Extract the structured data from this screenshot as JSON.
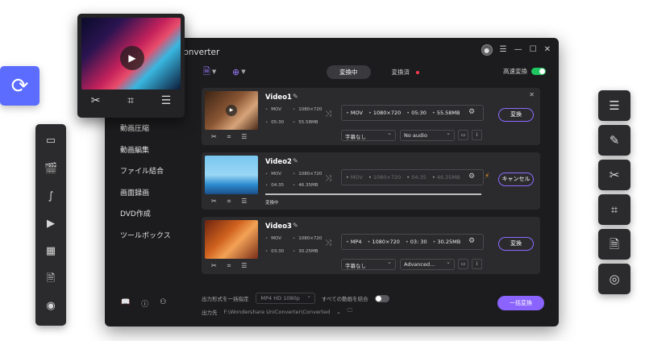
{
  "window": {
    "title": "Converter",
    "controls": [
      "account",
      "menu",
      "minimize",
      "maximize",
      "close"
    ]
  },
  "sidebar": {
    "items": [
      {
        "label": "動画圧縮"
      },
      {
        "label": "動画編集"
      },
      {
        "label": "ファイル結合"
      },
      {
        "label": "画面録画"
      },
      {
        "label": "DVD作成"
      },
      {
        "label": "ツールボックス"
      }
    ],
    "bottom_icons": [
      "book-icon",
      "help-icon",
      "users-icon"
    ]
  },
  "toolbar": {
    "add_file_icon": "add-file-icon",
    "add_media_icon": "add-media-icon",
    "tabs": [
      {
        "label": "変換中",
        "active": true
      },
      {
        "label": "変換済",
        "active": false
      }
    ],
    "speed_label": "高速変換",
    "speed_on": true
  },
  "videos": [
    {
      "name": "Video1",
      "src_format": "MOV",
      "src_resolution": "1080×720",
      "src_duration": "05:30",
      "src_size": "55.58MB",
      "out_format": "MOV",
      "out_resolution": "1080×720",
      "out_duration": "05:30",
      "out_size": "55.58MB",
      "subtitle": "字幕なし",
      "audio": "No audio",
      "action": "変換"
    },
    {
      "name": "Video2",
      "src_format": "MOV",
      "src_resolution": "1080×720",
      "src_duration": "04:35",
      "src_size": "46.35MB",
      "out_format": "MOV",
      "out_resolution": "1080×720",
      "out_duration": "04:35",
      "out_size": "46.35MB",
      "status": "変換中",
      "progress": 1.0,
      "action": "キャンセル"
    },
    {
      "name": "Video3",
      "src_format": "MOV",
      "src_resolution": "1080×720",
      "src_duration": "03:30",
      "src_size": "30.25MB",
      "out_format": "MP4",
      "out_resolution": "1080×720",
      "out_duration": "03: 30",
      "out_size": "30.25MB",
      "subtitle": "字幕なし",
      "audio": "Advanced...",
      "action": "変換"
    }
  ],
  "footer": {
    "output_format_label": "出力形式を一括指定",
    "output_format_value": "MP4 HD 1080p",
    "merge_label": "すべての動画を結合",
    "merge_on": false,
    "output_path_label": "出力先",
    "output_path_value": "F:\\Wondershare UniConverter\\Converted",
    "batch_button": "一括変換"
  },
  "floating": {
    "left_toolbar_icons": [
      "video-convert-icon",
      "video-clip-icon",
      "merge-icon",
      "screen-record-icon",
      "film-icon",
      "document-icon",
      "dvd-icon"
    ],
    "sync_icon": "sync-icon",
    "preview_tools": [
      "scissors-icon",
      "crop-icon",
      "adjust-icon"
    ],
    "right_tiles": [
      "adjust-icon",
      "edit-doc-icon",
      "scissors-icon",
      "crop-icon",
      "subtitle-icon",
      "audio-icon"
    ]
  },
  "colors": {
    "accent": "#8b63ff",
    "sync_blue": "#5b6cff",
    "toggle_on": "#1ec760",
    "warn_orange": "#ff9d2e",
    "dot_red": "#ff3b4e"
  }
}
